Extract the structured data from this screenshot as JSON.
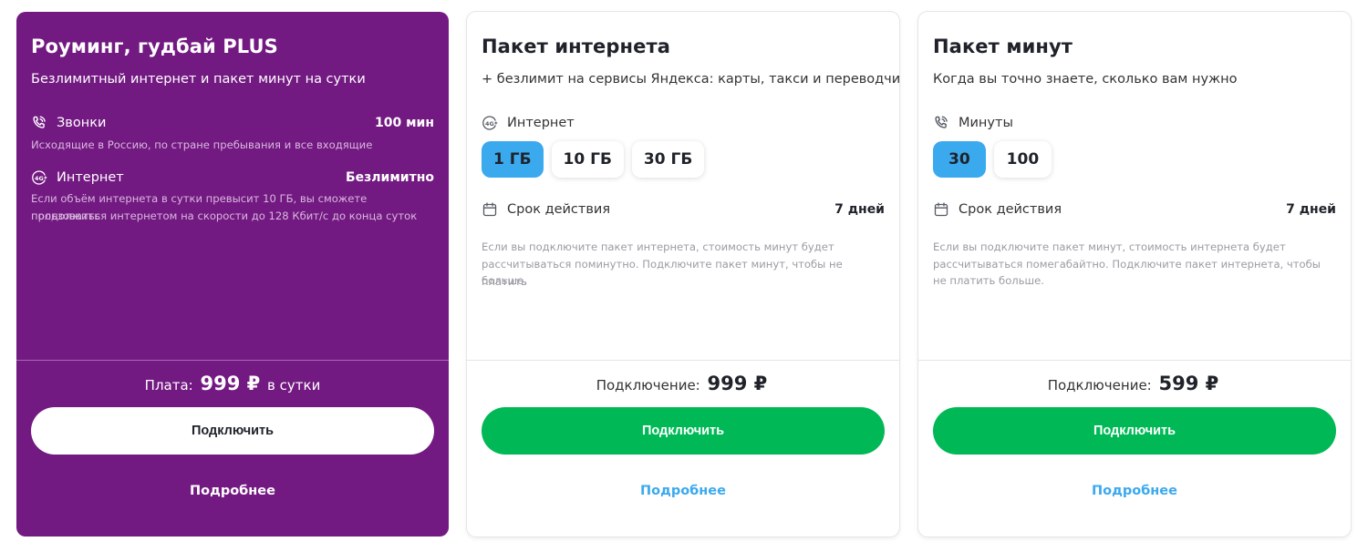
{
  "colors": {
    "purple_card": "#731982",
    "green_button": "#00b956",
    "accent_blue": "#3ba9ee",
    "note_gray": "#9a9ca3"
  },
  "cards": [
    {
      "title": "Роуминг, гудбай PLUS",
      "subtitle": "Безлимитный интернет и пакет минут на сутки",
      "calls": {
        "icon": "phone-icon",
        "label": "Звонки",
        "value": "100 мин",
        "note": "Исходящие в Россию, по стране пребывания и все входящие"
      },
      "internet": {
        "icon": "4g-icon",
        "label": "Интернет",
        "value": "Безлимитно",
        "note_line1": "Если объём интернета в сутки превысит 10 ГБ, вы сможете продолжить",
        "note_line2": "пользоваться интернетом на скорости до 128 Кбит/с до конца суток"
      },
      "price_prefix": "Плата:",
      "price_amount": "999 ₽",
      "price_suffix": "в сутки",
      "button": "Подключить",
      "more": "Подробнее"
    },
    {
      "title": "Пакет интернета",
      "subtitle": "+ безлимит на сервисы Яндекса: карты, такси и переводчик",
      "option": {
        "icon": "4g-icon",
        "label": "Интернет"
      },
      "chips": [
        {
          "label": "1 ГБ",
          "selected": true
        },
        {
          "label": "10 ГБ",
          "selected": false
        },
        {
          "label": "30 ГБ",
          "selected": false
        }
      ],
      "validity": {
        "icon": "calendar-icon",
        "label": "Срок действия",
        "value": "7 дней"
      },
      "note_line1": "Если вы подключите пакет интернета, стоимость минут будет",
      "note_line2": "рассчитываться поминутно. Подключите пакет минут, чтобы не платить",
      "note_line3": "больше.",
      "price_prefix": "Подключение:",
      "price_amount": "999 ₽",
      "button": "Подключить",
      "more": "Подробнее"
    },
    {
      "title": "Пакет минут",
      "subtitle": "Когда вы точно знаете, сколько вам нужно",
      "option": {
        "icon": "phone-icon",
        "label": "Минуты"
      },
      "chips": [
        {
          "label": "30",
          "selected": true
        },
        {
          "label": "100",
          "selected": false
        }
      ],
      "validity": {
        "icon": "calendar-icon",
        "label": "Срок действия",
        "value": "7 дней"
      },
      "note_line1": "Если вы подключите пакет минут, стоимость интернета будет",
      "note_line2": "рассчитываться помегабайтно. Подключите пакет интернета, чтобы",
      "note_line3": "не платить больше.",
      "price_prefix": "Подключение:",
      "price_amount": "599 ₽",
      "button": "Подключить",
      "more": "Подробнее"
    }
  ]
}
